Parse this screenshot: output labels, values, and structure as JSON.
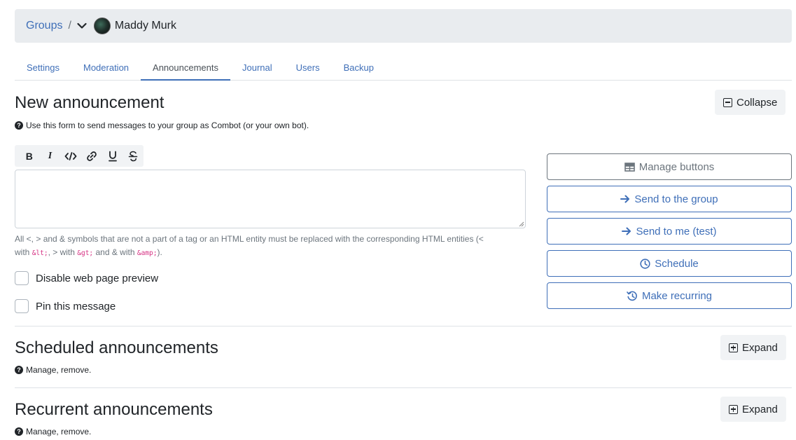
{
  "breadcrumb": {
    "root": "Groups",
    "separator": "/",
    "group_name": "Maddy Murk"
  },
  "tabs": [
    {
      "label": "Settings",
      "active": false
    },
    {
      "label": "Moderation",
      "active": false
    },
    {
      "label": "Announcements",
      "active": true
    },
    {
      "label": "Journal",
      "active": false
    },
    {
      "label": "Users",
      "active": false
    },
    {
      "label": "Backup",
      "active": false
    }
  ],
  "new_announcement": {
    "title": "New announcement",
    "help": "Use this form to send messages to your group as Combot (or your own bot).",
    "collapse_label": "Collapse",
    "format_buttons": [
      "bold",
      "italic",
      "code",
      "link",
      "underline",
      "strikethrough"
    ],
    "editor_value": "",
    "hint_prefix": "All <, > and & symbols that are not a part of a tag or an HTML entity must be replaced with the corresponding HTML entities (<",
    "hint_with1": " with ",
    "hint_lt": "&lt;",
    "hint_mid1": ", > with ",
    "hint_gt": "&gt;",
    "hint_mid2": " and & with ",
    "hint_amp": "&amp;",
    "hint_end": ").",
    "disable_preview_label": "Disable web page preview",
    "pin_label": "Pin this message",
    "buttons": {
      "manage": "Manage buttons",
      "send_group": "Send to the group",
      "send_me": "Send to me (test)",
      "schedule": "Schedule",
      "recurring": "Make recurring"
    }
  },
  "scheduled": {
    "title": "Scheduled announcements",
    "help": "Manage, remove.",
    "expand_label": "Expand"
  },
  "recurrent": {
    "title": "Recurrent announcements",
    "help": "Manage, remove.",
    "expand_label": "Expand"
  },
  "colors": {
    "accent": "#3f6fb8",
    "muted": "#6c757d",
    "breadcrumb_bg": "#e9ecef"
  }
}
